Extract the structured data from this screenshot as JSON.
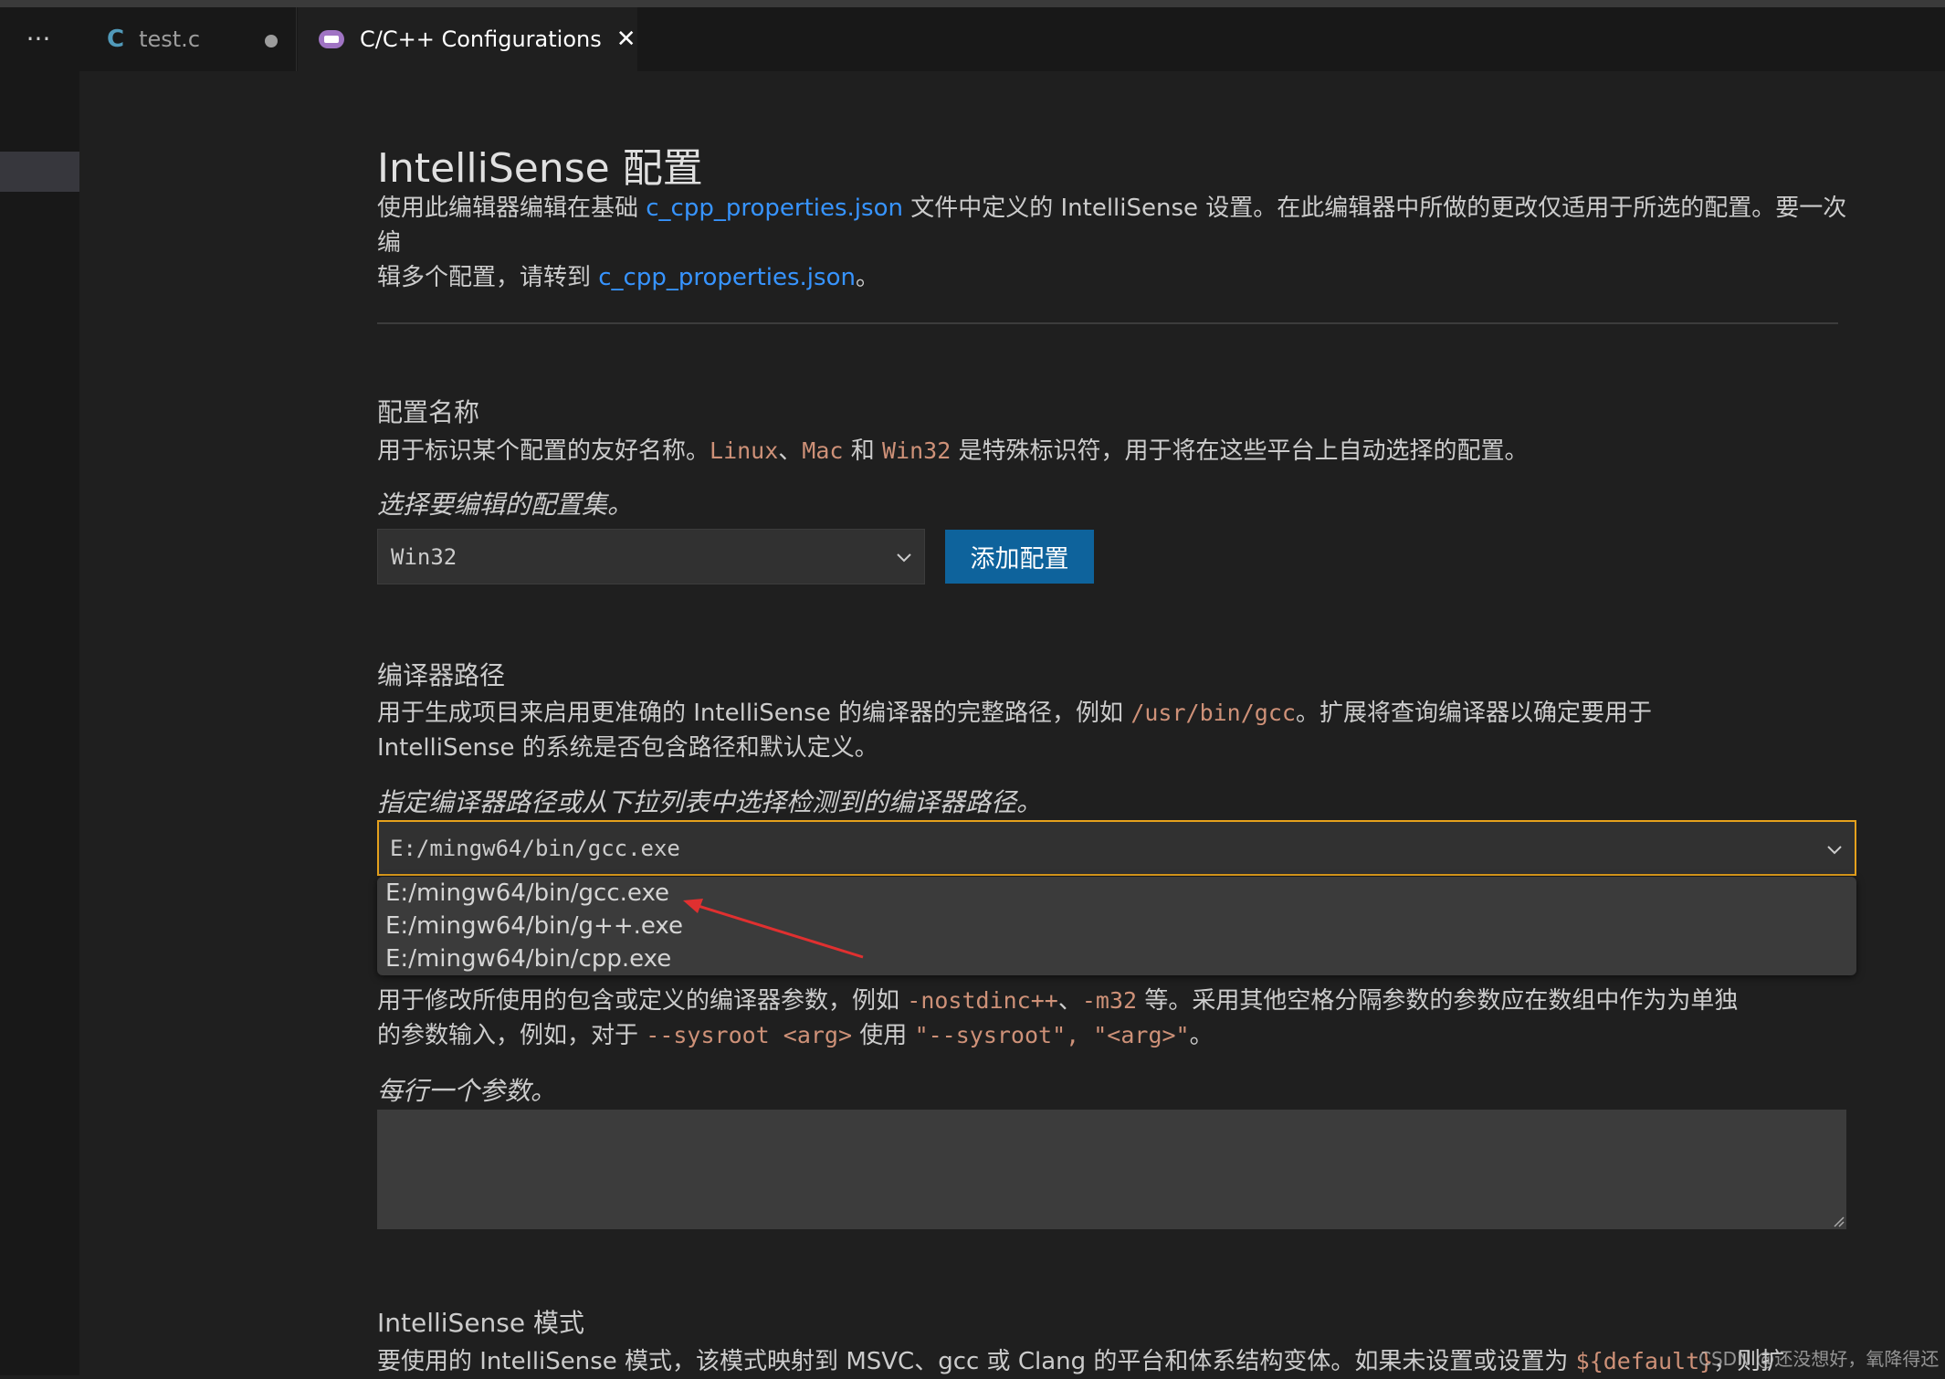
{
  "tabs": {
    "more_label": "···",
    "tab1": {
      "icon_text": "C",
      "label": "test.c"
    },
    "tab2": {
      "label": "C/C++ Configurations",
      "close": "✕"
    }
  },
  "page": {
    "title": "IntelliSense 配置",
    "intro_part1": "使用此编辑器编辑在基础 ",
    "intro_link1": "c_cpp_properties.json",
    "intro_part2": " 文件中定义的 IntelliSense 设置。在此编辑器中所做的更改仅适用于所选的配置。要一次编",
    "intro_part3": "辑多个配置，请转到 ",
    "intro_link2": "c_cpp_properties.json",
    "intro_part4": "。"
  },
  "config_name": {
    "heading": "配置名称",
    "desc_part1": "用于标识某个配置的友好名称。",
    "code_linux": "Linux",
    "sep1": "、",
    "code_mac": "Mac",
    "and": " 和 ",
    "code_win32": "Win32",
    "desc_part2": " 是特殊标识符，用于将在这些平台上自动选择的配置。",
    "hint": "选择要编辑的配置集。",
    "selected": "Win32",
    "add_button": "添加配置"
  },
  "compiler_path": {
    "heading": "编译器路径",
    "desc_part1": "用于生成项目来启用更准确的 IntelliSense 的编译器的完整路径，例如 ",
    "code_example": "/usr/bin/gcc",
    "desc_part2": "。扩展将查询编译器以确定要用于",
    "desc_line2": "IntelliSense 的系统是否包含路径和默认定义。",
    "hint": "指定编译器路径或从下拉列表中选择检测到的编译器路径。",
    "value": "E:/mingw64/bin/gcc.exe",
    "options": [
      "E:/mingw64/bin/gcc.exe",
      "E:/mingw64/bin/g++.exe",
      "E:/mingw64/bin/cpp.exe"
    ]
  },
  "compiler_args": {
    "desc_part1": "用于修改所使用的包含或定义的编译器参数，例如 ",
    "code1": "-nostdinc++",
    "sep": "、",
    "code2": "-m32",
    "desc_part2": " 等。采用其他空格分隔参数的参数应在数组中作为为单独",
    "line2_part1": "的参数输入，例如，对于 ",
    "code3": "--sysroot <arg>",
    "line2_part2": " 使用 ",
    "code4": "\"--sysroot\", \"<arg>\"",
    "line2_part3": "。",
    "hint": "每行一个参数。"
  },
  "intellisense_mode": {
    "heading": "IntelliSense 模式",
    "desc_part1": "要使用的 IntelliSense 模式，该模式映射到 MSVC、gcc 或 Clang 的平台和体系结构变体。如果未设置或设置为 ",
    "code": "${default}",
    "desc_part2": "，则扩"
  },
  "watermark": "CSDN @还没想好，氧降得还"
}
